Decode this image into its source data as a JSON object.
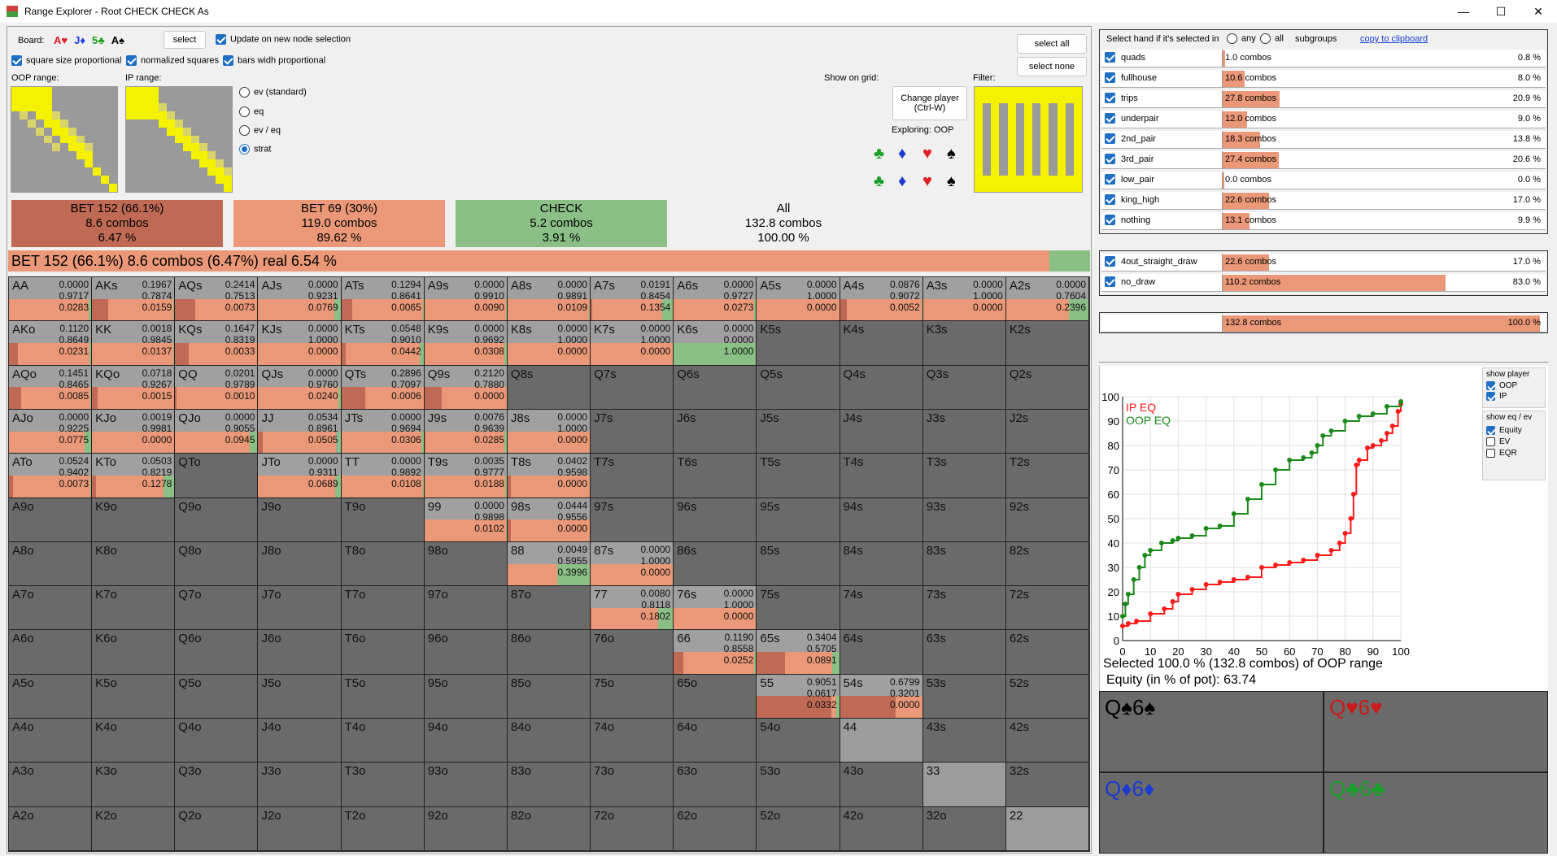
{
  "window": {
    "title": "Range Explorer  - Root CHECK CHECK As",
    "minimize": "—",
    "maximize": "☐",
    "close": "✕"
  },
  "board": {
    "label": "Board:",
    "cards": [
      {
        "text": "A♥",
        "color": "#e02020"
      },
      {
        "text": "J♦",
        "color": "#2040e0"
      },
      {
        "text": "5♣",
        "color": "#20a020"
      },
      {
        "text": "A♠",
        "color": "#000000"
      }
    ],
    "select_label": "select",
    "update_label": "Update on new node selection"
  },
  "options": {
    "square_size": "square size proportional",
    "normalized": "normalized squares",
    "bars_width": "bars widh proportional",
    "oop_range": "OOP range:",
    "ip_range": "IP range:",
    "radio": [
      "ev (standard)",
      "eq",
      "ev / eq",
      "strat"
    ],
    "show_on_grid": "Show on grid:",
    "change_player": "Change player\n(Ctrl-W)",
    "exploring": "Exploring: OOP",
    "filter": "Filter:",
    "select_all": "select all",
    "select_none": "select none",
    "suits_row1": [
      "♣",
      "♦",
      "♥",
      "♠"
    ],
    "suits_row2": [
      "♣",
      "♦",
      "♥",
      "♠"
    ]
  },
  "summary": [
    {
      "line1": "BET 152 (66.1%)",
      "line2": "8.6 combos",
      "line3": "6.47 %",
      "color": "#c06a55"
    },
    {
      "line1": "BET 69 (30%)",
      "line2": "119.0 combos",
      "line3": "89.62 %",
      "color": "#ea9877"
    },
    {
      "line1": "CHECK",
      "line2": "5.2 combos",
      "line3": "3.91 %",
      "color": "#8abf86"
    },
    {
      "line1": "All",
      "line2": "132.8 combos",
      "line3": "100.00 %",
      "color": "#f0f0f0"
    }
  ],
  "big_bar": "BET 152 (66.1%)   8.6 combos (6.47%) real  6.54 %",
  "grid": [
    [
      [
        "AA",
        "0.0000",
        "0.9717",
        "0.0283"
      ],
      [
        "AKs",
        "0.1967",
        "0.7874",
        "0.0159"
      ],
      [
        "AQs",
        "0.2414",
        "0.7513",
        "0.0073"
      ],
      [
        "AJs",
        "0.0000",
        "0.9231",
        "0.0769"
      ],
      [
        "ATs",
        "0.1294",
        "0.8641",
        "0.0065"
      ],
      [
        "A9s",
        "0.0000",
        "0.9910",
        "0.0090"
      ],
      [
        "A8s",
        "0.0000",
        "0.9891",
        "0.0109"
      ],
      [
        "A7s",
        "0.0191",
        "0.8454",
        "0.1354"
      ],
      [
        "A6s",
        "0.0000",
        "0.9727",
        "0.0273"
      ],
      [
        "A5s",
        "0.0000",
        "1.0000",
        "0.0000"
      ],
      [
        "A4s",
        "0.0876",
        "0.9072",
        "0.0052"
      ],
      [
        "A3s",
        "0.0000",
        "1.0000",
        "0.0000"
      ],
      [
        "A2s",
        "0.0000",
        "0.7604",
        "0.2396"
      ]
    ],
    [
      [
        "AKo",
        "0.1120",
        "0.8649",
        "0.0231"
      ],
      [
        "KK",
        "0.0018",
        "0.9845",
        "0.0137"
      ],
      [
        "KQs",
        "0.1647",
        "0.8319",
        "0.0033"
      ],
      [
        "KJs",
        "0.0000",
        "1.0000",
        "0.0000"
      ],
      [
        "KTs",
        "0.0548",
        "0.9010",
        "0.0442"
      ],
      [
        "K9s",
        "0.0000",
        "0.9692",
        "0.0308"
      ],
      [
        "K8s",
        "0.0000",
        "1.0000",
        "0.0000"
      ],
      [
        "K7s",
        "0.0000",
        "1.0000",
        "0.0000"
      ],
      [
        "K6s",
        "0.0000",
        "0.0000",
        "1.0000"
      ],
      [
        "K5s"
      ],
      [
        "K4s"
      ],
      [
        "K3s"
      ],
      [
        "K2s"
      ]
    ],
    [
      [
        "AQo",
        "0.1451",
        "0.8465",
        "0.0085"
      ],
      [
        "KQo",
        "0.0718",
        "0.9267",
        "0.0015"
      ],
      [
        "QQ",
        "0.0201",
        "0.9789",
        "0.0010"
      ],
      [
        "QJs",
        "0.0000",
        "0.9760",
        "0.0240"
      ],
      [
        "QTs",
        "0.2896",
        "0.7097",
        "0.0006"
      ],
      [
        "Q9s",
        "0.2120",
        "0.7880",
        "0.0000"
      ],
      [
        "Q8s"
      ],
      [
        "Q7s"
      ],
      [
        "Q6s"
      ],
      [
        "Q5s"
      ],
      [
        "Q4s"
      ],
      [
        "Q3s"
      ],
      [
        "Q2s"
      ]
    ],
    [
      [
        "AJo",
        "0.0000",
        "0.9225",
        "0.0775"
      ],
      [
        "KJo",
        "0.0019",
        "0.9981",
        "0.0000"
      ],
      [
        "QJo",
        "0.0000",
        "0.9055",
        "0.0945"
      ],
      [
        "JJ",
        "0.0534",
        "0.8961",
        "0.0505"
      ],
      [
        "JTs",
        "0.0000",
        "0.9694",
        "0.0306"
      ],
      [
        "J9s",
        "0.0076",
        "0.9639",
        "0.0285"
      ],
      [
        "J8s",
        "0.0000",
        "1.0000",
        "0.0000"
      ],
      [
        "J7s"
      ],
      [
        "J6s"
      ],
      [
        "J5s"
      ],
      [
        "J4s"
      ],
      [
        "J3s"
      ],
      [
        "J2s"
      ]
    ],
    [
      [
        "ATo",
        "0.0524",
        "0.9402",
        "0.0073"
      ],
      [
        "KTo",
        "0.0503",
        "0.8219",
        "0.1278"
      ],
      [
        "QTo"
      ],
      [
        "JTo",
        "0.0000",
        "0.9311",
        "0.0689"
      ],
      [
        "TT",
        "0.0000",
        "0.9892",
        "0.0108"
      ],
      [
        "T9s",
        "0.0035",
        "0.9777",
        "0.0188"
      ],
      [
        "T8s",
        "0.0402",
        "0.9598",
        "0.0000"
      ],
      [
        "T7s"
      ],
      [
        "T6s"
      ],
      [
        "T5s"
      ],
      [
        "T4s"
      ],
      [
        "T3s"
      ],
      [
        "T2s"
      ]
    ],
    [
      [
        "A9o"
      ],
      [
        "K9o"
      ],
      [
        "Q9o"
      ],
      [
        "J9o"
      ],
      [
        "T9o"
      ],
      [
        "99",
        "0.0000",
        "0.9898",
        "0.0102"
      ],
      [
        "98s",
        "0.0444",
        "0.9556",
        "0.0000"
      ],
      [
        "97s"
      ],
      [
        "96s"
      ],
      [
        "95s"
      ],
      [
        "94s"
      ],
      [
        "93s"
      ],
      [
        "92s"
      ]
    ],
    [
      [
        "A8o"
      ],
      [
        "K8o"
      ],
      [
        "Q8o"
      ],
      [
        "J8o"
      ],
      [
        "T8o"
      ],
      [
        "98o"
      ],
      [
        "88",
        "0.0049",
        "0.5955",
        "0.3996"
      ],
      [
        "87s",
        "0.0000",
        "1.0000",
        "0.0000"
      ],
      [
        "86s"
      ],
      [
        "85s"
      ],
      [
        "84s"
      ],
      [
        "83s"
      ],
      [
        "82s"
      ]
    ],
    [
      [
        "A7o"
      ],
      [
        "K7o"
      ],
      [
        "Q7o"
      ],
      [
        "J7o"
      ],
      [
        "T7o"
      ],
      [
        "97o"
      ],
      [
        "87o"
      ],
      [
        "77",
        "0.0080",
        "0.8118",
        "0.1802"
      ],
      [
        "76s",
        "0.0000",
        "1.0000",
        "0.0000"
      ],
      [
        "75s"
      ],
      [
        "74s"
      ],
      [
        "73s"
      ],
      [
        "72s"
      ]
    ],
    [
      [
        "A6o"
      ],
      [
        "K6o"
      ],
      [
        "Q6o"
      ],
      [
        "J6o"
      ],
      [
        "T6o"
      ],
      [
        "96o"
      ],
      [
        "86o"
      ],
      [
        "76o"
      ],
      [
        "66",
        "0.1190",
        "0.8558",
        "0.0252"
      ],
      [
        "65s",
        "0.3404",
        "0.5705",
        "0.0891"
      ],
      [
        "64s"
      ],
      [
        "63s"
      ],
      [
        "62s"
      ]
    ],
    [
      [
        "A5o"
      ],
      [
        "K5o"
      ],
      [
        "Q5o"
      ],
      [
        "J5o"
      ],
      [
        "T5o"
      ],
      [
        "95o"
      ],
      [
        "85o"
      ],
      [
        "75o"
      ],
      [
        "65o"
      ],
      [
        "55",
        "0.9051",
        "0.0617",
        "0.0332"
      ],
      [
        "54s",
        "0.6799",
        "0.3201",
        "0.0000"
      ],
      [
        "53s"
      ],
      [
        "52s"
      ]
    ],
    [
      [
        "A4o"
      ],
      [
        "K4o"
      ],
      [
        "Q4o"
      ],
      [
        "J4o"
      ],
      [
        "T4o"
      ],
      [
        "94o"
      ],
      [
        "84o"
      ],
      [
        "74o"
      ],
      [
        "64o"
      ],
      [
        "54o"
      ],
      [
        "44"
      ],
      [
        "43s"
      ],
      [
        "42s"
      ]
    ],
    [
      [
        "A3o"
      ],
      [
        "K3o"
      ],
      [
        "Q3o"
      ],
      [
        "J3o"
      ],
      [
        "T3o"
      ],
      [
        "93o"
      ],
      [
        "83o"
      ],
      [
        "73o"
      ],
      [
        "63o"
      ],
      [
        "53o"
      ],
      [
        "43o"
      ],
      [
        "33"
      ],
      [
        "32s"
      ]
    ],
    [
      [
        "A2o"
      ],
      [
        "K2o"
      ],
      [
        "Q2o"
      ],
      [
        "J2o"
      ],
      [
        "T2o"
      ],
      [
        "92o"
      ],
      [
        "82o"
      ],
      [
        "72o"
      ],
      [
        "62o"
      ],
      [
        "52o"
      ],
      [
        "42o"
      ],
      [
        "32o"
      ],
      [
        "22"
      ]
    ]
  ],
  "right": {
    "header": "Select hand if it's selected in",
    "any": "any",
    "all": "all",
    "subgroups": "subgroups",
    "copy": "copy to clipboard",
    "groups": [
      {
        "name": "quads",
        "combos": "1.0 combos",
        "pct": "0.8 %",
        "fill": 0.008
      },
      {
        "name": "fullhouse",
        "combos": "10.6 combos",
        "pct": "8.0 %",
        "fill": 0.08
      },
      {
        "name": "trips",
        "combos": "27.8 combos",
        "pct": "20.9 %",
        "fill": 0.209
      },
      {
        "name": "underpair",
        "combos": "12.0 combos",
        "pct": "9.0 %",
        "fill": 0.09
      },
      {
        "name": "2nd_pair",
        "combos": "18.3 combos",
        "pct": "13.8 %",
        "fill": 0.138
      },
      {
        "name": "3rd_pair",
        "combos": "27.4 combos",
        "pct": "20.6 %",
        "fill": 0.206
      },
      {
        "name": "low_pair",
        "combos": "0.0 combos",
        "pct": "0.0 %",
        "fill": 0.0
      },
      {
        "name": "king_high",
        "combos": "22.6 combos",
        "pct": "17.0 %",
        "fill": 0.17
      },
      {
        "name": "nothing",
        "combos": "13.1 combos",
        "pct": "9.9 %",
        "fill": 0.099
      }
    ],
    "draws": [
      {
        "name": "4out_straight_draw",
        "combos": "22.6 combos",
        "pct": "17.0 %",
        "fill": 0.17
      },
      {
        "name": "no_draw",
        "combos": "110.2 combos",
        "pct": "83.0 %",
        "fill": 0.83
      }
    ],
    "total": {
      "combos": "132.8 combos",
      "pct": "100.0 %",
      "fill": 1.0
    }
  },
  "eq_chart": {
    "series_labels": [
      "IP EQ",
      "OOP EQ"
    ],
    "series_colors": [
      "#ff1a1a",
      "#1a8a1a"
    ],
    "ticks": [
      "0",
      "10",
      "20",
      "30",
      "40",
      "50",
      "60",
      "70",
      "80",
      "90",
      "100"
    ],
    "selected_text": "Selected 100.0 % (132.8 combos) of OOP range",
    "equity_text": "Equity (in % of pot): 63.74",
    "show_player": "show player",
    "oop": "OOP",
    "ip": "IP",
    "show_eq": "show eq / ev",
    "equity": "Equity",
    "ev": "EV",
    "eqr": "EQR"
  },
  "chart_data": {
    "type": "line",
    "title": "",
    "xlabel": "",
    "ylabel": "",
    "xlim": [
      0,
      100
    ],
    "ylim": [
      0,
      100
    ],
    "series": [
      {
        "name": "IP EQ",
        "x": [
          0,
          2,
          5,
          10,
          15,
          18,
          20,
          25,
          30,
          35,
          40,
          45,
          50,
          55,
          60,
          65,
          70,
          75,
          78,
          80,
          82,
          83,
          84,
          85,
          88,
          90,
          93,
          95,
          97,
          99,
          100
        ],
        "y": [
          6,
          7,
          8,
          11,
          13,
          16,
          19,
          21,
          23,
          24,
          25,
          26,
          30,
          31,
          32,
          33,
          35,
          37,
          40,
          44,
          50,
          60,
          72,
          74,
          79,
          80,
          82,
          85,
          88,
          94,
          97
        ]
      },
      {
        "name": "OOP EQ",
        "x": [
          0,
          1,
          2,
          4,
          6,
          8,
          10,
          14,
          18,
          20,
          25,
          30,
          35,
          40,
          45,
          50,
          55,
          60,
          65,
          68,
          70,
          72,
          75,
          80,
          85,
          90,
          95,
          100
        ],
        "y": [
          10,
          15,
          19,
          25,
          30,
          35,
          37,
          40,
          41,
          42,
          43,
          46,
          47,
          52,
          58,
          64,
          70,
          74,
          75,
          77,
          80,
          84,
          86,
          90,
          92,
          93,
          96,
          98
        ]
      }
    ]
  },
  "hands": [
    {
      "text": "Q♠6♠",
      "color": "#000000"
    },
    {
      "text": "Q♥6♥",
      "color": "#cc1a1a"
    },
    {
      "text": "Q♦6♦",
      "color": "#1a3ad0"
    },
    {
      "text": "Q♣6♣",
      "color": "#1aa02a"
    }
  ]
}
